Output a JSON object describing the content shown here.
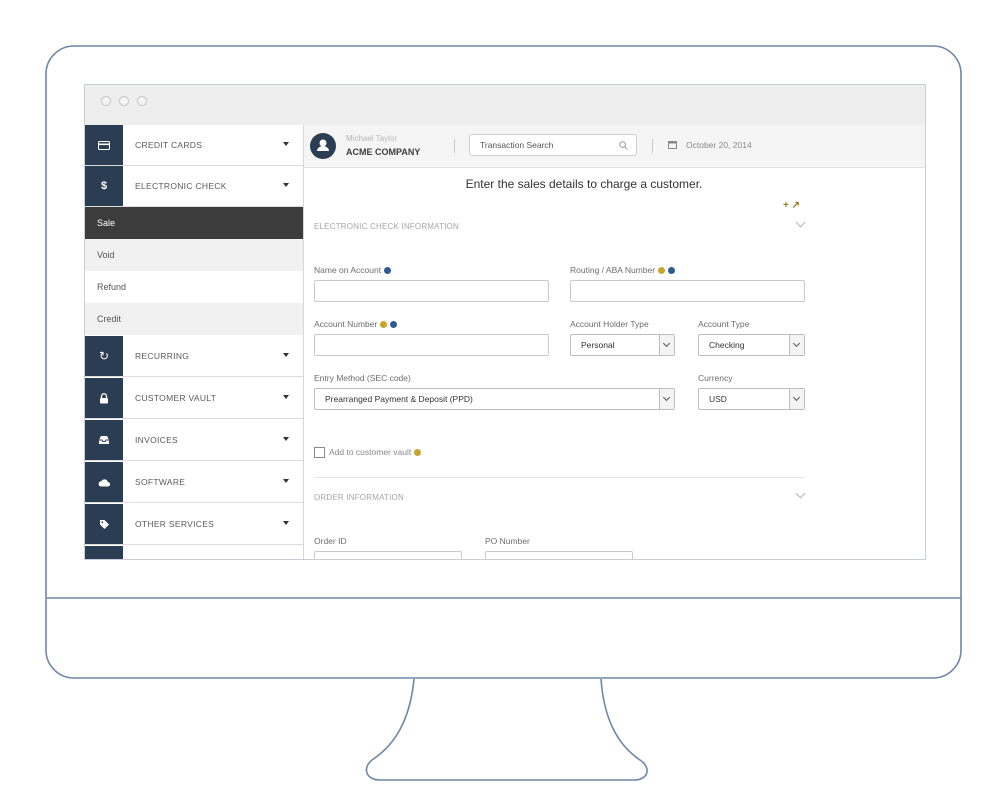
{
  "sidebar": {
    "items": [
      {
        "label": "CREDIT CARDS",
        "icon": "credit-card-icon"
      },
      {
        "label": "ELECTRONIC CHECK",
        "icon": "dollar-icon"
      },
      {
        "label": "RECURRING",
        "icon": "refresh-icon"
      },
      {
        "label": "CUSTOMER VAULT",
        "icon": "lock-icon"
      },
      {
        "label": "INVOICES",
        "icon": "inbox-icon"
      },
      {
        "label": "SOFTWARE",
        "icon": "cloud-icon"
      },
      {
        "label": "OTHER SERVICES",
        "icon": "tag-icon"
      }
    ],
    "sub_items": [
      "Sale",
      "Void",
      "Refund",
      "Credit"
    ],
    "active_sub_item": "Sale"
  },
  "header": {
    "user_name": "Michael Taylor",
    "company": "ACME COMPANY",
    "search_placeholder": "Transaction Search",
    "date": "October 20, 2014"
  },
  "form": {
    "headline": "Enter the sales details to charge a customer.",
    "tools_glyphs": "+ ↗",
    "section_check": "ELECTRONIC CHECK INFORMATION",
    "name_on_account_label": "Name on Account",
    "routing_label": "Routing / ABA Number",
    "account_number_label": "Account Number",
    "account_holder_type_label": "Account Holder Type",
    "account_holder_type_value": "Personal",
    "account_type_label": "Account Type",
    "account_type_value": "Checking",
    "entry_method_label": "Entry Method (SEC code)",
    "entry_method_value": "Prearranged Payment & Deposit (PPD)",
    "currency_label": "Currency",
    "currency_value": "USD",
    "add_vault_label": "Add to customer vault",
    "section_order": "ORDER INFORMATION",
    "order_id_label": "Order ID",
    "po_number_label": "PO Number"
  },
  "colors": {
    "sidebar_icon_bg": "#2b3d52",
    "active_item_bg": "#3c3c3c",
    "info_yellow": "#c7a52a",
    "info_blue": "#2f5a94"
  }
}
